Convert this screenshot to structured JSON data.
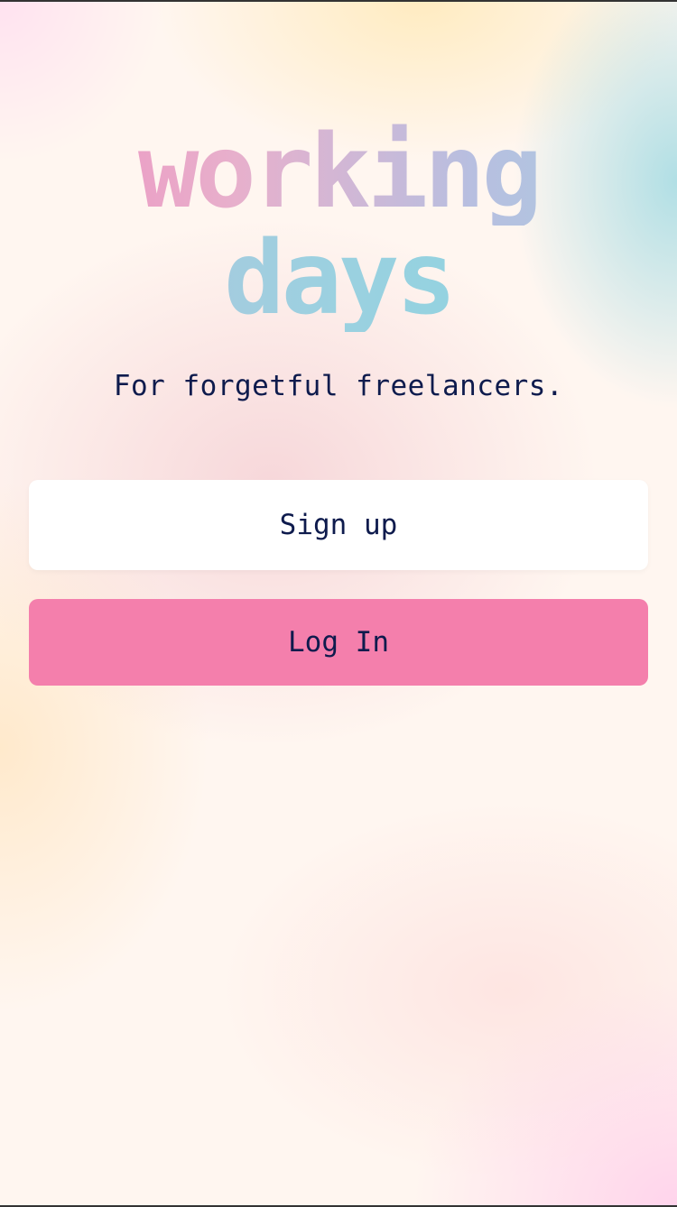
{
  "app": {
    "logo_line1": "working",
    "logo_line2": "days",
    "tagline": "For forgetful freelancers."
  },
  "actions": {
    "signup_label": "Sign up",
    "login_label": "Log In"
  },
  "colors": {
    "primary_text": "#0e1b4d",
    "login_button": "#f47fac",
    "signup_button": "#ffffff"
  }
}
